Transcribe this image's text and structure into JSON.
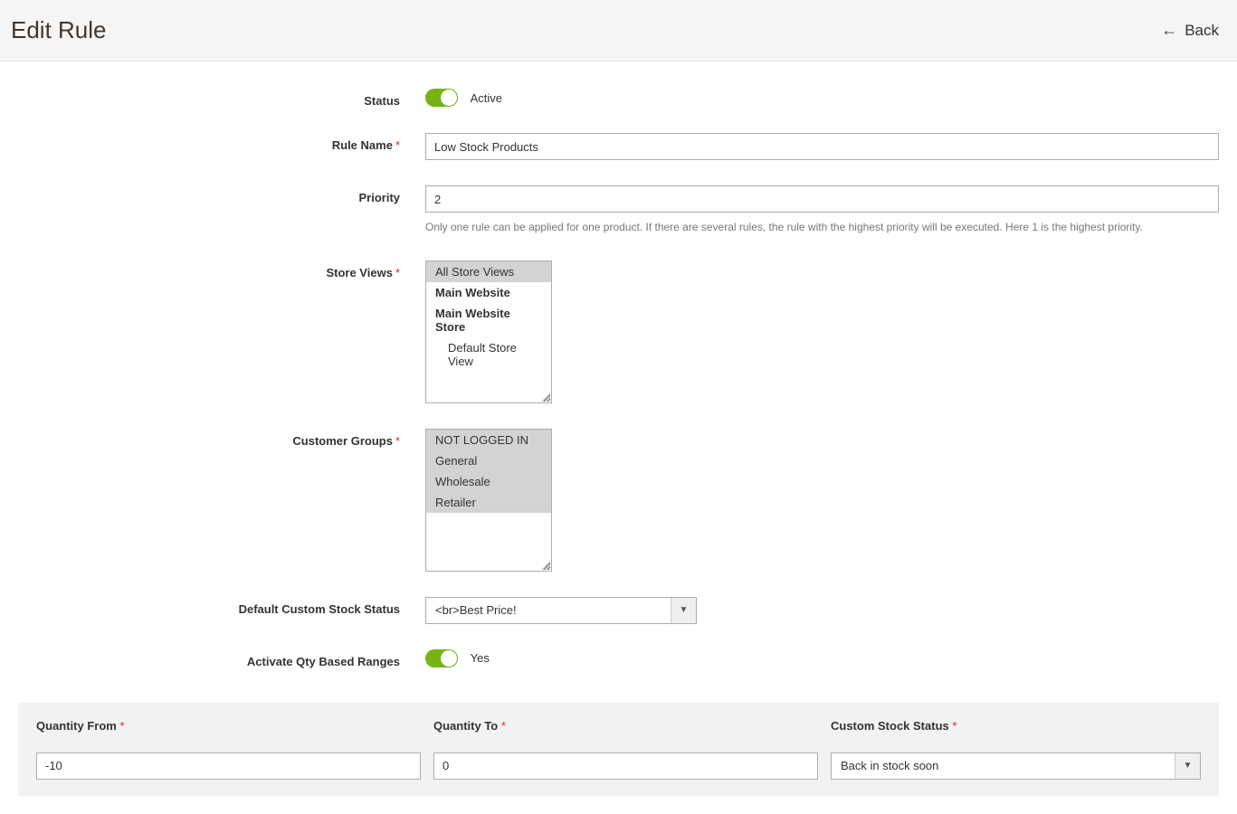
{
  "header": {
    "title": "Edit Rule",
    "back_label": "Back"
  },
  "form": {
    "status": {
      "label": "Status",
      "text": "Active",
      "on": true
    },
    "rule_name": {
      "label": "Rule Name",
      "required": true,
      "value": "Low Stock Products"
    },
    "priority": {
      "label": "Priority",
      "value": "2",
      "helper": "Only one rule can be applied for one product. If there are several rules, the rule with the highest priority will be executed. Here 1 is the highest priority."
    },
    "store_views": {
      "label": "Store Views",
      "required": true,
      "options": [
        {
          "label": "All Store Views",
          "selected": true
        },
        {
          "label": "Main Website",
          "bold": true
        },
        {
          "label": "Main Website Store",
          "bold": true
        },
        {
          "label": "Default Store View",
          "indent": true
        }
      ]
    },
    "customer_groups": {
      "label": "Customer Groups",
      "required": true,
      "options": [
        {
          "label": "NOT LOGGED IN",
          "selected": true
        },
        {
          "label": "General",
          "selected": true
        },
        {
          "label": "Wholesale",
          "selected": true
        },
        {
          "label": "Retailer",
          "selected": true
        }
      ]
    },
    "default_custom_stock_status": {
      "label": "Default Custom Stock Status",
      "value": "<br>Best Price!"
    },
    "activate_qty_ranges": {
      "label": "Activate Qty Based Ranges",
      "text": "Yes",
      "on": true
    }
  },
  "qty_table": {
    "headers": {
      "from": "Quantity From",
      "to": "Quantity To",
      "status": "Custom Stock Status"
    },
    "rows": [
      {
        "from": "-10",
        "to": "0",
        "status": "Back in stock soon"
      }
    ]
  }
}
